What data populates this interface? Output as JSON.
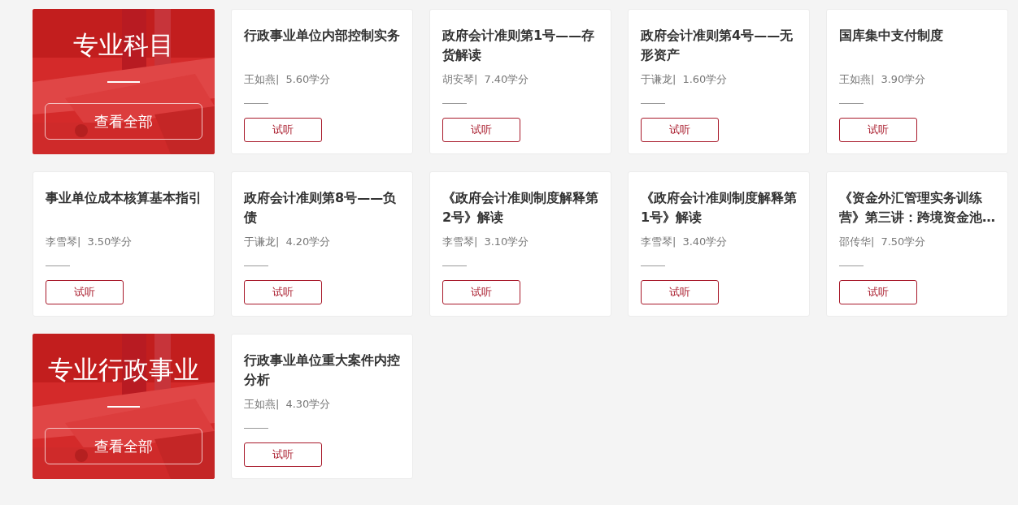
{
  "sections": [
    {
      "category": {
        "title": "专业科目",
        "button": "查看全部"
      },
      "courses": [
        {
          "title": "行政事业单位内部控制实务",
          "teacher": "王如燕|",
          "credits": "5.60学分",
          "button": "试听"
        },
        {
          "title": "政府会计准则第1号——存货解读",
          "teacher": "胡安琴|",
          "credits": "7.40学分",
          "button": "试听"
        },
        {
          "title": "政府会计准则第4号——无形资产",
          "teacher": "于谦龙|",
          "credits": "1.60学分",
          "button": "试听"
        },
        {
          "title": "国库集中支付制度",
          "teacher": "王如燕|",
          "credits": "3.90学分",
          "button": "试听"
        },
        {
          "title": "事业单位成本核算基本指引",
          "teacher": "李雪琴|",
          "credits": "3.50学分",
          "button": "试听"
        },
        {
          "title": "政府会计准则第8号——负债",
          "teacher": "于谦龙|",
          "credits": "4.20学分",
          "button": "试听"
        },
        {
          "title": "《政府会计准则制度解释第2号》解读",
          "teacher": "李雪琴|",
          "credits": "3.10学分",
          "button": "试听"
        },
        {
          "title": "《政府会计准则制度解释第1号》解读",
          "teacher": "李雪琴|",
          "credits": "3.40学分",
          "button": "试听"
        },
        {
          "title": "《资金外汇管理实务训练营》第三讲：跨境资金池…",
          "teacher": "邵传华|",
          "credits": "7.50学分",
          "button": "试听"
        }
      ]
    },
    {
      "category": {
        "title": "专业行政事业",
        "button": "查看全部"
      },
      "courses": [
        {
          "title": "行政事业单位重大案件内控分析",
          "teacher": "王如燕|",
          "credits": "4.30学分",
          "button": "试听"
        }
      ]
    }
  ]
}
